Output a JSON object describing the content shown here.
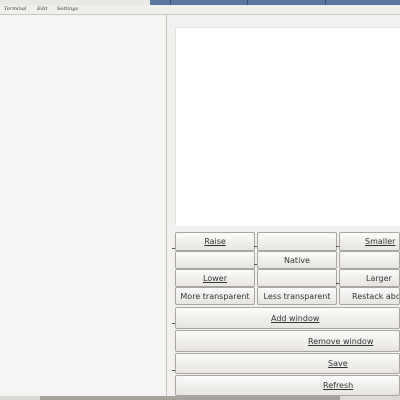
{
  "menu": {
    "items": [
      "Terminal",
      "Edit",
      "Settings"
    ]
  },
  "buttons": {
    "raise": "Raise",
    "smaller": "Smaller",
    "native": "Native",
    "lower": "Lower",
    "larger": "Larger",
    "more_transparent": "More transparent",
    "less_transparent": "Less transparent",
    "restack_above": "Restack above",
    "add_window": "Add window",
    "remove_window": "Remove window",
    "save": "Save",
    "refresh": "Refresh"
  }
}
